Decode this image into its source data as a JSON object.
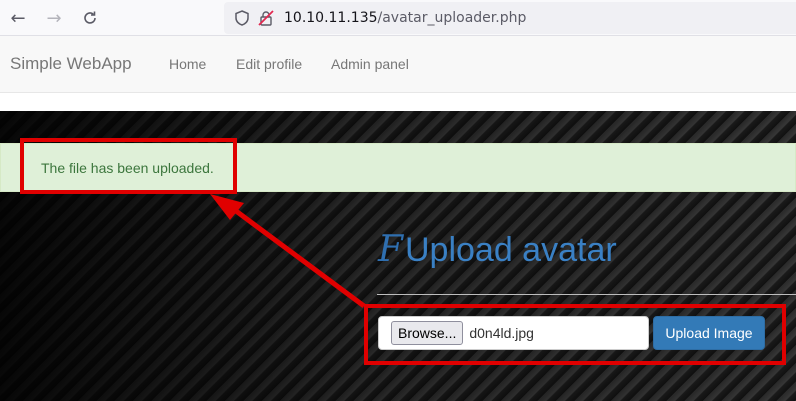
{
  "browser": {
    "url_host": "10.10.11.135",
    "url_path": "/avatar_uploader.php"
  },
  "navbar": {
    "brand": "Simple WebApp",
    "links": [
      "Home",
      "Edit profile",
      "Admin panel"
    ]
  },
  "alert": {
    "message": "The file has been uploaded."
  },
  "upload": {
    "title": "Upload avatar",
    "title_icon": "F",
    "browse_label": "Browse...",
    "file_name": "d0n4ld.jpg",
    "submit_label": "Upload Image"
  },
  "colors": {
    "annotation": "#e00000",
    "alert_bg": "#dff0d8",
    "alert_text": "#3c763d",
    "primary": "#337ab7",
    "title": "#3a80c4"
  },
  "icons": {
    "back": "arrow-left-icon",
    "forward": "arrow-right-icon",
    "reload": "reload-icon",
    "shield": "shield-icon",
    "insecure_lock": "insecure-lock-icon"
  }
}
